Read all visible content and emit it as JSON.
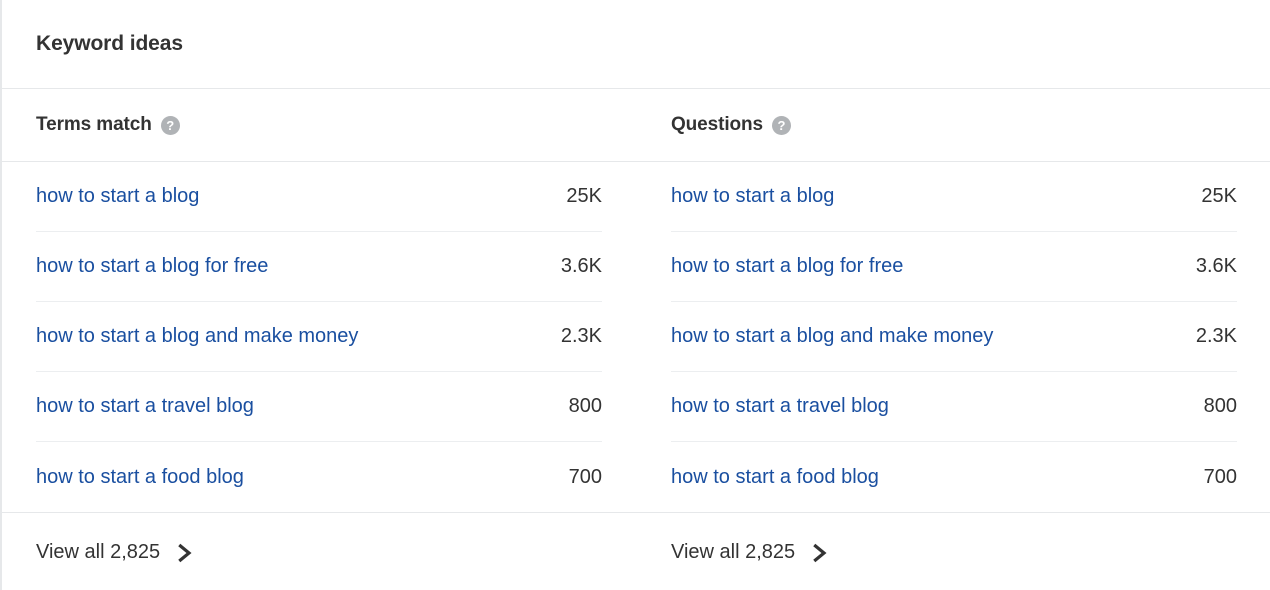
{
  "card": {
    "title": "Keyword ideas"
  },
  "columns": [
    {
      "header": "Terms match",
      "help_icon": "help-icon",
      "help_glyph": "?",
      "rows": [
        {
          "keyword": "how to start a blog",
          "volume": "25K"
        },
        {
          "keyword": "how to start a blog for free",
          "volume": "3.6K"
        },
        {
          "keyword": "how to start a blog and make money",
          "volume": "2.3K"
        },
        {
          "keyword": "how to start a travel blog",
          "volume": "800"
        },
        {
          "keyword": "how to start a food blog",
          "volume": "700"
        }
      ],
      "view_all": "View all 2,825",
      "chevron_icon": "chevron-right-icon"
    },
    {
      "header": "Questions",
      "help_icon": "help-icon",
      "help_glyph": "?",
      "rows": [
        {
          "keyword": "how to start a blog",
          "volume": "25K"
        },
        {
          "keyword": "how to start a blog for free",
          "volume": "3.6K"
        },
        {
          "keyword": "how to start a blog and make money",
          "volume": "2.3K"
        },
        {
          "keyword": "how to start a travel blog",
          "volume": "800"
        },
        {
          "keyword": "how to start a food blog",
          "volume": "700"
        }
      ],
      "view_all": "View all 2,825",
      "chevron_icon": "chevron-right-icon"
    }
  ],
  "colors": {
    "link": "#1a4fa0",
    "text": "#333333",
    "divider": "#e6e8ea",
    "row_divider": "#eceef0",
    "help_icon_bg": "#b0b3b6"
  }
}
